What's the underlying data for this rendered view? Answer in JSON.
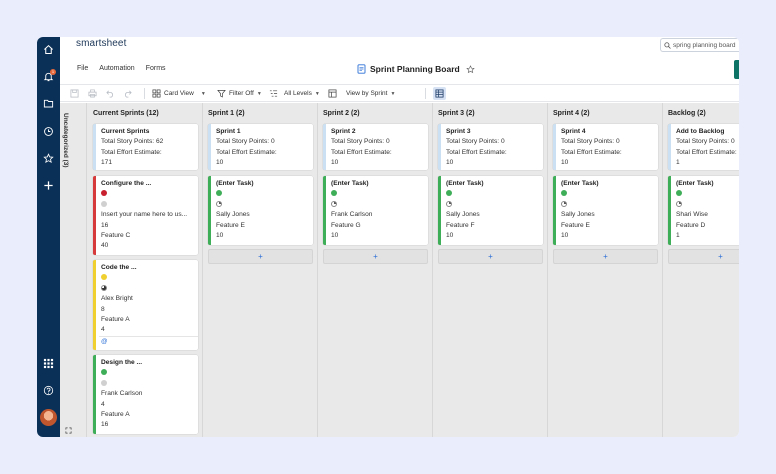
{
  "app": {
    "logo": "smartsheet",
    "doc_title": "Sprint Planning Board"
  },
  "search": {
    "text": "spring planning board"
  },
  "menu": [
    "File",
    "Automation",
    "Forms"
  ],
  "toolbar": {
    "card_view": "Card View",
    "filter": "Filter Off",
    "levels": "All Levels",
    "view_by": "View by Sprint"
  },
  "rail": {
    "notification_count": "1"
  },
  "uncategorized": "Uncategorized (3)",
  "lanes": [
    {
      "title": "Current Sprints (12)",
      "summary": {
        "title": "Current Sprints",
        "points": "Total Story Points: 62",
        "effort": "Total Effort Estimate:",
        "effort_value": "171"
      },
      "tasks": [
        {
          "title": "Configure the ...",
          "status_color": "#c8202f",
          "progress": "empty",
          "assignee": "Insert your name here to us...",
          "points": "16",
          "feature": "Feature C",
          "effort": "40",
          "bar": "#d63a3a"
        },
        {
          "title": "Code the ...",
          "status_color": "#f0d030",
          "progress": "three-quarter",
          "assignee": "Alex Bright",
          "points": "8",
          "feature": "Feature A",
          "effort": "4",
          "bar": "#f0d030",
          "mention": "@"
        },
        {
          "title": "Design the ...",
          "status_color": "#3fae58",
          "progress": "empty",
          "assignee": "Frank Carlson",
          "points": "4",
          "feature": "Feature A",
          "effort": "16",
          "bar": "#3fae58"
        }
      ]
    },
    {
      "title": "Sprint 1 (2)",
      "summary": {
        "title": "Sprint 1",
        "points": "Total Story Points: 0",
        "effort": "Total Effort Estimate:",
        "effort_value": "10"
      },
      "tasks": [
        {
          "title": "(Enter Task)",
          "status_color": "#3fae58",
          "progress": "quarter",
          "assignee": "Sally Jones",
          "points": "",
          "feature": "Feature E",
          "effort": "10",
          "bar": "#3fae58"
        }
      ],
      "add_label": "+"
    },
    {
      "title": "Sprint 2 (2)",
      "summary": {
        "title": "Sprint 2",
        "points": "Total Story Points: 0",
        "effort": "Total Effort Estimate:",
        "effort_value": "10"
      },
      "tasks": [
        {
          "title": "(Enter Task)",
          "status_color": "#3fae58",
          "progress": "quarter",
          "assignee": "Frank Carlson",
          "points": "",
          "feature": "Feature G",
          "effort": "10",
          "bar": "#3fae58"
        }
      ],
      "add_label": "+"
    },
    {
      "title": "Sprint 3 (2)",
      "summary": {
        "title": "Sprint 3",
        "points": "Total Story Points: 0",
        "effort": "Total Effort Estimate:",
        "effort_value": "10"
      },
      "tasks": [
        {
          "title": "(Enter Task)",
          "status_color": "#3fae58",
          "progress": "quarter",
          "assignee": "Sally Jones",
          "points": "",
          "feature": "Feature F",
          "effort": "10",
          "bar": "#3fae58"
        }
      ],
      "add_label": "+"
    },
    {
      "title": "Sprint 4 (2)",
      "summary": {
        "title": "Sprint 4",
        "points": "Total Story Points: 0",
        "effort": "Total Effort Estimate:",
        "effort_value": "10"
      },
      "tasks": [
        {
          "title": "(Enter Task)",
          "status_color": "#3fae58",
          "progress": "quarter",
          "assignee": "Sally Jones",
          "points": "",
          "feature": "Feature E",
          "effort": "10",
          "bar": "#3fae58"
        }
      ],
      "add_label": "+"
    },
    {
      "title": "Backlog (2)",
      "summary": {
        "title": "Add to Backlog",
        "points": "Total Story Points: 0",
        "effort": "Total Effort Estimate:",
        "effort_value": "1"
      },
      "tasks": [
        {
          "title": "(Enter Task)",
          "status_color": "#3fae58",
          "progress": "quarter",
          "assignee": "Shari Wise",
          "points": "",
          "feature": "Feature D",
          "effort": "1",
          "bar": "#3fae58"
        }
      ],
      "add_label": "+"
    }
  ]
}
